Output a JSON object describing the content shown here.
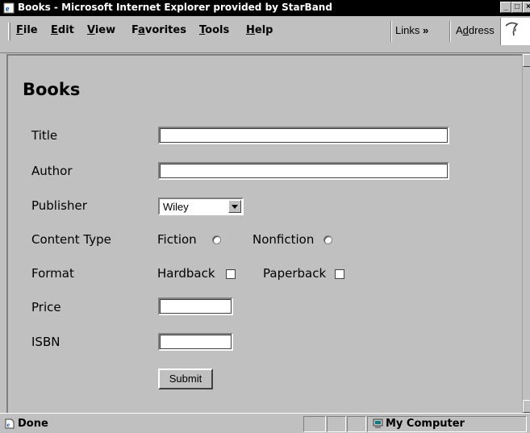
{
  "window": {
    "title": "Books - Microsoft Internet Explorer provided by StarBand"
  },
  "menu": {
    "items": [
      {
        "pre": "",
        "ul": "F",
        "post": "ile"
      },
      {
        "pre": "",
        "ul": "E",
        "post": "dit"
      },
      {
        "pre": "",
        "ul": "V",
        "post": "iew"
      },
      {
        "pre": "F",
        "ul": "a",
        "post": "vorites"
      },
      {
        "pre": "",
        "ul": "T",
        "post": "ools"
      },
      {
        "pre": "",
        "ul": "H",
        "post": "elp"
      }
    ],
    "links_label": "Links",
    "links_chevron": "»",
    "address_pre": "A",
    "address_ul": "d",
    "address_post": "dress"
  },
  "page": {
    "heading": "Books",
    "fields": {
      "title_label": "Title",
      "title_value": "",
      "author_label": "Author",
      "author_value": "",
      "publisher_label": "Publisher",
      "publisher_selected": "Wiley",
      "content_type_label": "Content Type",
      "fiction_label": "Fiction",
      "fiction_selected": false,
      "nonfiction_label": "Nonfiction",
      "nonfiction_selected": false,
      "format_label": "Format",
      "hardback_label": "Hardback",
      "hardback_checked": false,
      "paperback_label": "Paperback",
      "paperback_checked": false,
      "price_label": "Price",
      "price_value": "",
      "isbn_label": "ISBN",
      "isbn_value": ""
    },
    "submit_label": "Submit"
  },
  "status": {
    "text": "Done",
    "zone": "My Computer"
  },
  "icons": {
    "app": "ie-page-icon",
    "status": "page-done-icon",
    "zone": "my-computer-icon"
  }
}
